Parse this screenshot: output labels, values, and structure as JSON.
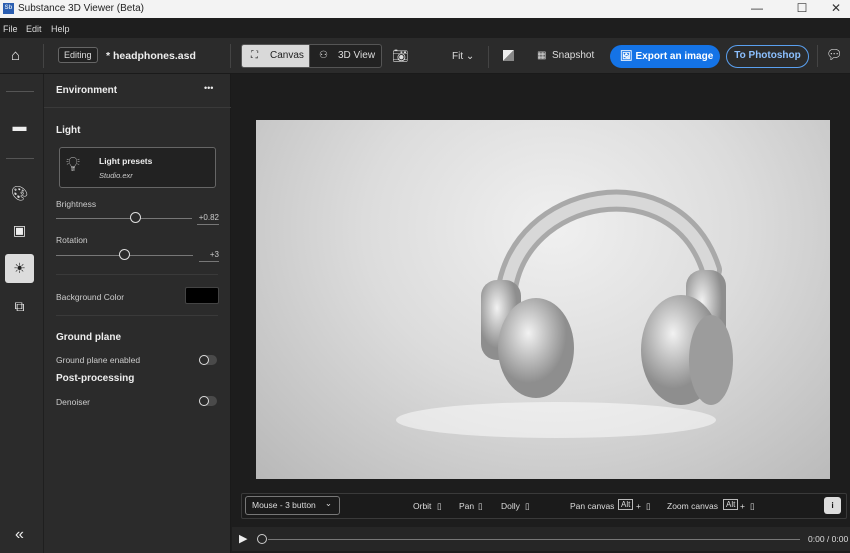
{
  "window": {
    "title": "Substance 3D Viewer (Beta)",
    "logo": "Sb",
    "minimize": "—",
    "maximize": "☐",
    "close": "✕"
  },
  "menu": [
    "File",
    "Edit",
    "Help"
  ],
  "toolbar": {
    "mode_badge": "Editing",
    "file_name": "* headphones.asd",
    "canvas_tab": "Canvas",
    "view3d_tab": "3D View",
    "fit_label": "Fit",
    "snapshot_label": "Snapshot",
    "export_label": "Export an image",
    "photoshop_label": "To Photoshop",
    "accent": "#1473e6"
  },
  "panel": {
    "title": "Environment",
    "more": "•••",
    "light_heading": "Light",
    "light_presets_title": "Light presets",
    "light_presets_value": "Studio.exr",
    "brightness_label": "Brightness",
    "brightness_value": "+0.82",
    "brightness_fraction": 0.59,
    "rotation_label": "Rotation",
    "rotation_value": "+3",
    "rotation_fraction": 0.5,
    "background_color_label": "Background Color",
    "background_color": "#000000",
    "ground_plane_heading": "Ground plane",
    "ground_plane_enabled_label": "Ground plane enabled",
    "ground_plane_enabled": false,
    "post_processing_heading": "Post-processing",
    "denoiser_label": "Denoiser",
    "denoiser": false
  },
  "controls": {
    "mouse_mode": "Mouse - 3 button",
    "orbit": "Orbit",
    "pan": "Pan",
    "dolly": "Dolly",
    "pan_canvas": "Pan canvas",
    "zoom_canvas": "Zoom canvas",
    "alt_key": "Alt",
    "plus": "+",
    "info": "i"
  },
  "timeline": {
    "time": "0:00 / 0:00"
  },
  "rail": {
    "collapse": "«"
  }
}
